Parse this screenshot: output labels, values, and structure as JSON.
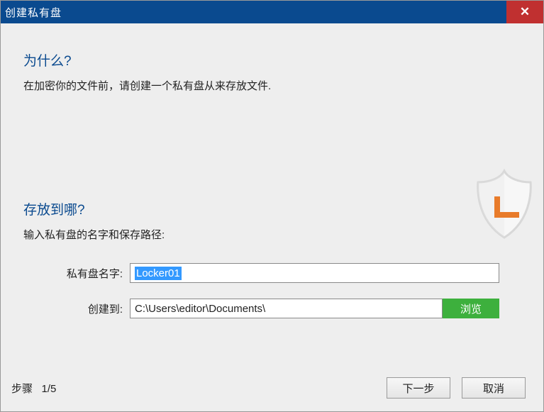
{
  "title_bar": {
    "title": "创建私有盘"
  },
  "sections": {
    "why": {
      "heading": "为什么?",
      "text": "在加密你的文件前，请创建一个私有盘从来存放文件."
    },
    "where": {
      "heading": "存放到哪?",
      "text": "输入私有盘的名字和保存路径:"
    }
  },
  "form": {
    "name_label": "私有盘名字:",
    "name_value": "Locker01",
    "path_label": "创建到:",
    "path_value": "C:\\Users\\editor\\Documents\\",
    "browse_label": "浏览"
  },
  "footer": {
    "step_label": "步骤",
    "step_value": "1/5",
    "next_label": "下一步",
    "cancel_label": "取消"
  }
}
